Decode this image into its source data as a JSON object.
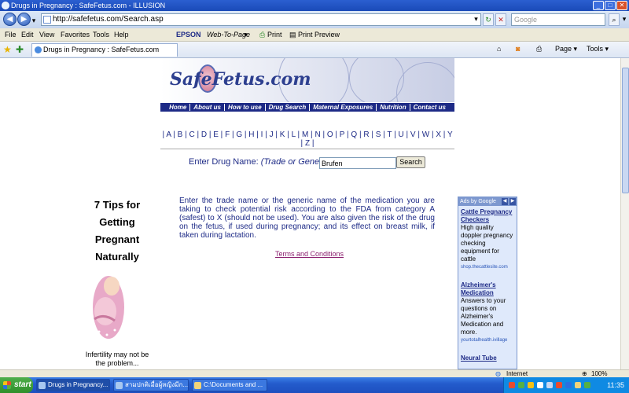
{
  "window": {
    "title": "Drugs in Pregnancy : SafeFetus.com - ILLUSION"
  },
  "address_bar": {
    "url": "http://safefetus.com/Search.asp",
    "search_placeholder": "Google"
  },
  "menu": [
    "File",
    "Edit",
    "View",
    "Favorites",
    "Tools",
    "Help"
  ],
  "toolbar_extras": {
    "epson": "EPSON",
    "web_to_page": "Web-To-Page",
    "print": "Print",
    "print_preview": "Print Preview"
  },
  "tab": {
    "label": "Drugs in Pregnancy : SafeFetus.com"
  },
  "command_bar": {
    "page": "Page",
    "tools": "Tools"
  },
  "site": {
    "logo": "SafeFetus.com",
    "nav": [
      "Home",
      "About us",
      "How to use",
      "Drug Search",
      "Maternal Exposures",
      "Nutrition",
      "Contact us"
    ],
    "alphabet": [
      "A",
      "B",
      "C",
      "D",
      "E",
      "F",
      "G",
      "H",
      "I",
      "J",
      "K",
      "L",
      "M",
      "N",
      "O",
      "P",
      "Q",
      "R",
      "S",
      "T",
      "U",
      "V",
      "W",
      "X",
      "Y",
      "Z"
    ],
    "search": {
      "label": "Enter Drug Name:",
      "label_note": "(Trade  or Generic)",
      "value": "Brufen",
      "button": "Search"
    },
    "promo": {
      "lines": [
        "7 Tips for",
        "Getting",
        "Pregnant",
        "Naturally"
      ],
      "sub": "Infertility may not be the problem..."
    },
    "description": "Enter the trade name or the generic name of the medication you are taking to check potential risk according to the FDA from category A (safest) to X (should not be used). You are also given the risk of the drug on the fetus, if used during pregnancy; and its effect on breast milk, if taken during lactation.",
    "terms": "Terms and Conditions",
    "ads": {
      "header": "Ads by Google",
      "items": [
        {
          "title": "Cattle Pregnancy Checkers",
          "body": "High quality doppler pregnancy checking equipment for cattle",
          "url": "shop.thecattlesite.com"
        },
        {
          "title": "Alzheimer's Medication",
          "body": "Answers to your questions on Alzheimer's Medication and more.",
          "url": "yourtotalhealth.ivillage"
        },
        {
          "title": "Neural Tube",
          "body": "",
          "url": ""
        }
      ]
    }
  },
  "status": {
    "zone": "Internet",
    "zoom": "100%"
  },
  "taskbar": {
    "start": "start",
    "tasks": [
      "Drugs in Pregnancy...",
      "สามปกติเมื่อผู้หญิงมีก...",
      "C:\\Documents and ..."
    ],
    "clock": "11:35"
  }
}
